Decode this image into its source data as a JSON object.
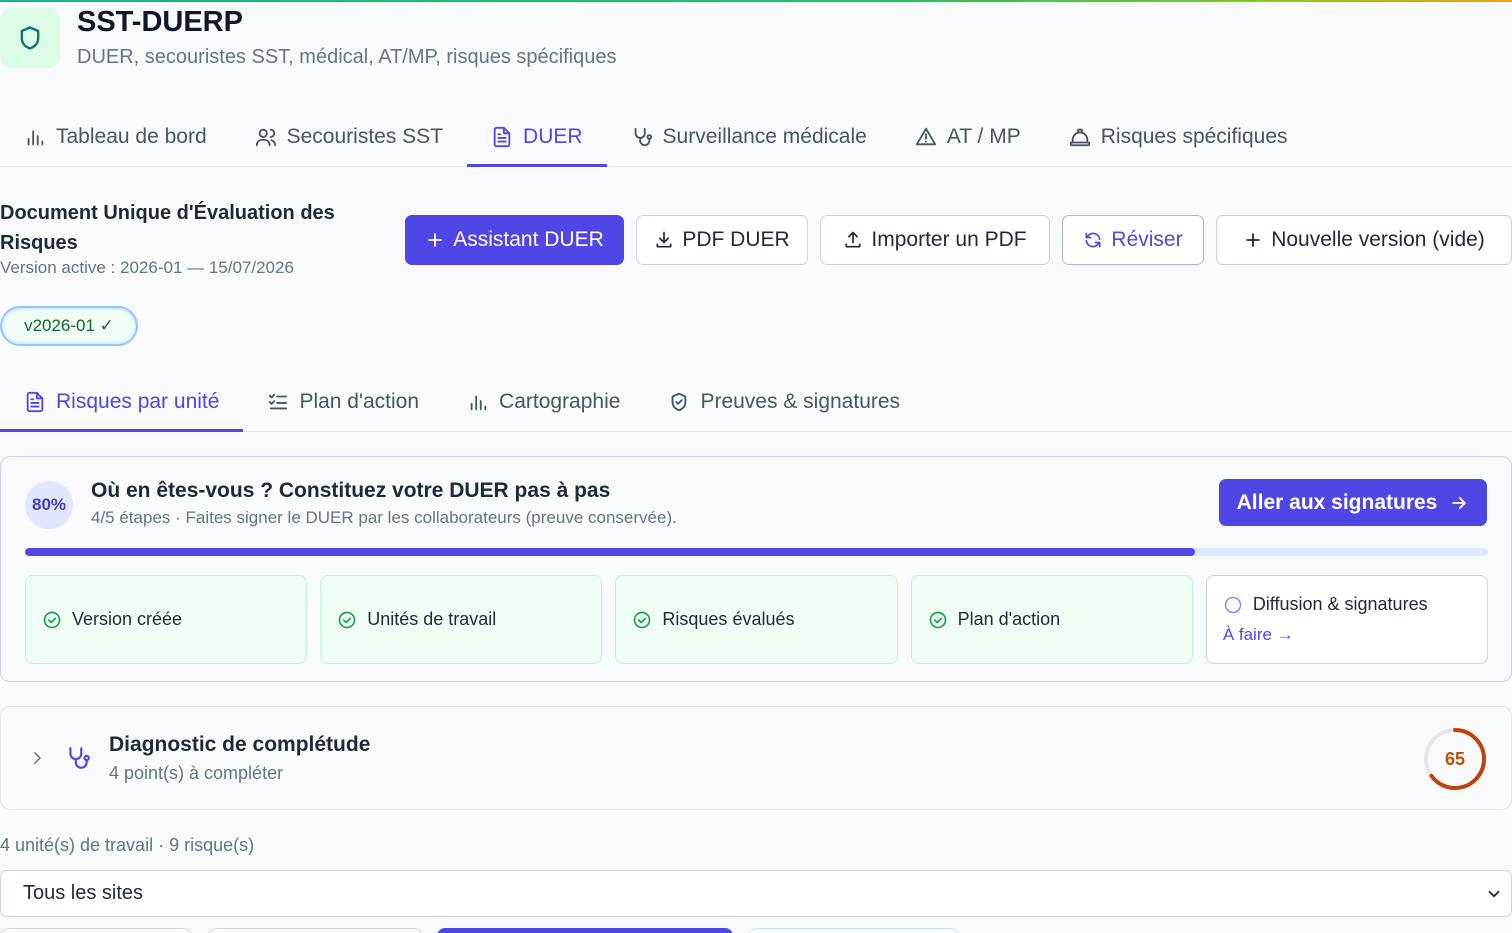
{
  "app": {
    "title": "SST-DUERP",
    "subtitle": "DUER, secouristes SST, médical, AT/MP, risques spécifiques",
    "icon": "shield-icon"
  },
  "main_tabs": [
    {
      "label": "Tableau de bord",
      "icon": "bar-chart-icon"
    },
    {
      "label": "Secouristes SST",
      "icon": "users-icon"
    },
    {
      "label": "DUER",
      "icon": "document-icon",
      "active": true
    },
    {
      "label": "Surveillance médicale",
      "icon": "stethoscope-icon"
    },
    {
      "label": "AT / MP",
      "icon": "warning-icon"
    },
    {
      "label": "Risques spécifiques",
      "icon": "hardhat-icon"
    }
  ],
  "document": {
    "title": "Document Unique d'Évaluation des Risques",
    "version_line": "Version active : 2026-01 — 15/07/2026",
    "version_pill": "v2026-01 ✓"
  },
  "toolbar": {
    "assistant": "Assistant DUER",
    "pdf": "PDF DUER",
    "import": "Importer un PDF",
    "revise": "Réviser",
    "new_version": "Nouvelle version (vide)"
  },
  "sub_tabs": [
    {
      "label": "Risques par unité",
      "icon": "document-icon",
      "active": true
    },
    {
      "label": "Plan d'action",
      "icon": "checklist-icon"
    },
    {
      "label": "Cartographie",
      "icon": "bar-chart-icon"
    },
    {
      "label": "Preuves & signatures",
      "icon": "shield-check-icon"
    }
  ],
  "progress": {
    "percent_label": "80%",
    "percent": 0.8,
    "title": "Où en êtes-vous ? Constituez votre DUER pas à pas",
    "subtitle": "4/5 étapes · Faites signer le DUER par les collaborateurs (preuve conservée).",
    "cta": "Aller aux signatures",
    "steps": [
      {
        "label": "Version créée",
        "done": true
      },
      {
        "label": "Unités de travail",
        "done": true
      },
      {
        "label": "Risques évalués",
        "done": true
      },
      {
        "label": "Plan d'action",
        "done": true
      },
      {
        "label": "Diffusion & signatures",
        "done": false,
        "link": "À faire →"
      }
    ]
  },
  "diagnostic": {
    "title": "Diagnostic de complétude",
    "subtitle": "4 point(s) à compléter",
    "score": "65",
    "score_value": 65
  },
  "units_summary": "4 unité(s) de travail · 9 risque(s)",
  "site_select": {
    "value": "Tous les sites"
  },
  "colors": {
    "accent": "#4f46e5",
    "success": "#16a34a",
    "warning": "#b45309"
  }
}
